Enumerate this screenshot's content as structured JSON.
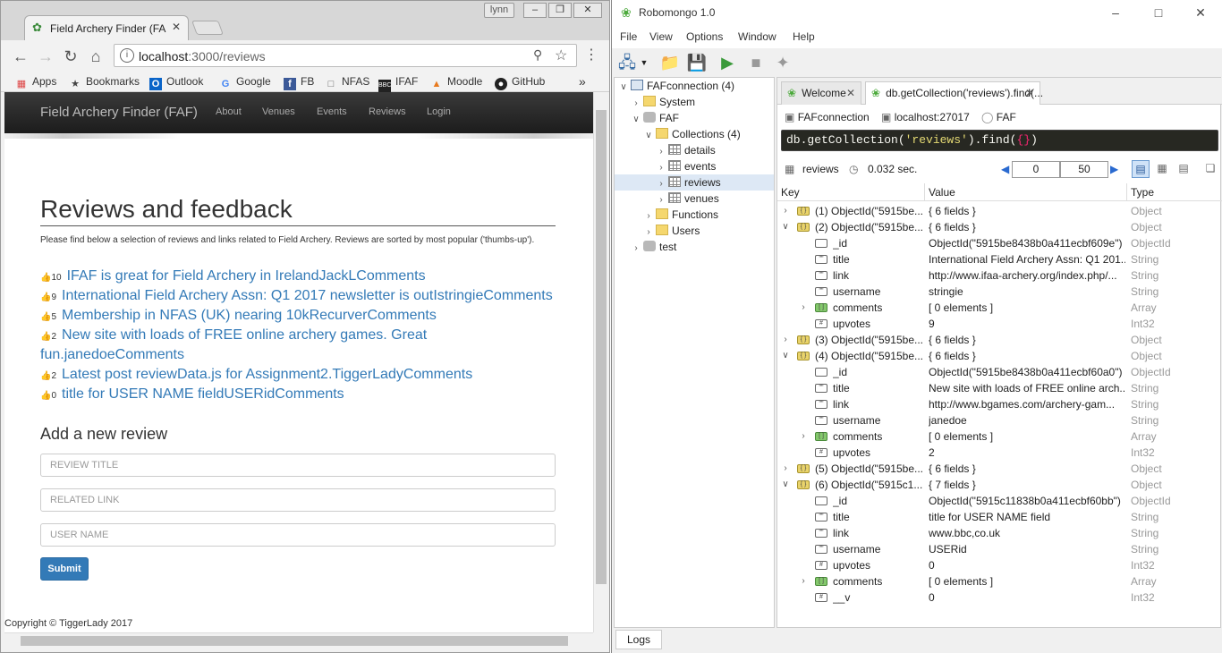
{
  "chrome": {
    "tab_title": "Field Archery Finder (FAF",
    "user": "lynn",
    "url_host": "localhost",
    "url_path": ":3000/reviews",
    "bookmarks": [
      "Apps",
      "Bookmarks",
      "Outlook",
      "Google",
      "FB",
      "NFAS",
      "IFAF",
      "Moodle",
      "GitHub"
    ],
    "bookmark_icons": [
      "apps-icon",
      "star-icon",
      "outlook-icon",
      "google-icon",
      "facebook-icon",
      "document-icon",
      "bbc-icon",
      "moodle-icon",
      "github-icon"
    ]
  },
  "site": {
    "brand": "Field Archery Finder (FAF)",
    "nav": [
      "About",
      "Venues",
      "Events",
      "Reviews",
      "Login"
    ],
    "heading": "Reviews and feedback",
    "intro": "Please find below a selection of reviews and links related to Field Archery. Reviews are sorted by most popular ('thumbs-up').",
    "reviews": [
      {
        "votes": "10",
        "text": "IFAF is great for Field Archery in IrelandJackLComments"
      },
      {
        "votes": "9",
        "text": "International Field Archery Assn: Q1 2017 newsletter is outIstringieComments"
      },
      {
        "votes": "5",
        "text": "Membership in NFAS (UK) nearing 10kRecurverComments"
      },
      {
        "votes": "2",
        "text": "New site with loads of FREE online archery games. Great"
      },
      {
        "votes": "",
        "text": "fun.janedoeComments"
      },
      {
        "votes": "2",
        "text": "Latest post reviewData.js for Assignment2.TiggerLadyComments"
      },
      {
        "votes": "0",
        "text": "title for USER NAME fieldUSERidComments"
      }
    ],
    "add_heading": "Add a new review",
    "fields": {
      "title": "REVIEW TITLE",
      "link": "RELATED LINK",
      "user": "USER NAME"
    },
    "submit": "Submit",
    "copyright": "Copyright © TiggerLady 2017"
  },
  "robo": {
    "title": "Robomongo 1.0",
    "menu": [
      "File",
      "View",
      "Options",
      "Window",
      "Help"
    ],
    "tree": [
      {
        "label": "FAFconnection (4)",
        "icon": "pc",
        "depth": 0,
        "arrow": "v"
      },
      {
        "label": "System",
        "icon": "folder",
        "depth": 1,
        "arrow": ">"
      },
      {
        "label": "FAF",
        "icon": "db",
        "depth": 1,
        "arrow": "v"
      },
      {
        "label": "Collections (4)",
        "icon": "folder",
        "depth": 2,
        "arrow": "v"
      },
      {
        "label": "details",
        "icon": "table",
        "depth": 3,
        "arrow": ">"
      },
      {
        "label": "events",
        "icon": "table",
        "depth": 3,
        "arrow": ">"
      },
      {
        "label": "reviews",
        "icon": "table",
        "depth": 3,
        "arrow": ">",
        "selected": true
      },
      {
        "label": "venues",
        "icon": "table",
        "depth": 3,
        "arrow": ">"
      },
      {
        "label": "Functions",
        "icon": "folder",
        "depth": 2,
        "arrow": ">"
      },
      {
        "label": "Users",
        "icon": "folder",
        "depth": 2,
        "arrow": ">"
      },
      {
        "label": "test",
        "icon": "db",
        "depth": 1,
        "arrow": ">"
      }
    ],
    "tabs": [
      "Welcome",
      "db.getCollection('reviews').find(..."
    ],
    "conn": {
      "name": "FAFconnection",
      "host": "localhost:27017",
      "db": "FAF"
    },
    "query_prefix": "db.getCollection(",
    "query_string": "'reviews'",
    "query_mid": ").find(",
    "query_obj": "{}",
    "query_end": ")",
    "results": {
      "collection": "reviews",
      "time": "0.032 sec.",
      "skip": "0",
      "limit": "50"
    },
    "columns": [
      "Key",
      "Value",
      "Type"
    ],
    "rows": [
      {
        "lvl": 0,
        "arrow": ">",
        "icon": "obj",
        "key": "(1) ObjectId(\"5915be...",
        "value": "{ 6 fields }",
        "type": "Object"
      },
      {
        "lvl": 0,
        "arrow": "v",
        "icon": "obj",
        "key": "(2) ObjectId(\"5915be...",
        "value": "{ 6 fields }",
        "type": "Object"
      },
      {
        "lvl": 1,
        "arrow": "",
        "icon": "oid",
        "key": "_id",
        "value": "ObjectId(\"5915be8438b0a411ecbf609e\")",
        "type": "ObjectId"
      },
      {
        "lvl": 1,
        "arrow": "",
        "icon": "str",
        "key": "title",
        "value": "International Field Archery Assn: Q1 201...",
        "type": "String"
      },
      {
        "lvl": 1,
        "arrow": "",
        "icon": "str",
        "key": "link",
        "value": "http://www.ifaa-archery.org/index.php/...",
        "type": "String"
      },
      {
        "lvl": 1,
        "arrow": "",
        "icon": "str",
        "key": "username",
        "value": "stringie",
        "type": "String"
      },
      {
        "lvl": 1,
        "arrow": ">",
        "icon": "arr",
        "key": "comments",
        "value": "[ 0 elements ]",
        "type": "Array"
      },
      {
        "lvl": 1,
        "arrow": "",
        "icon": "num",
        "key": "upvotes",
        "value": "9",
        "type": "Int32"
      },
      {
        "lvl": 0,
        "arrow": ">",
        "icon": "obj",
        "key": "(3) ObjectId(\"5915be...",
        "value": "{ 6 fields }",
        "type": "Object"
      },
      {
        "lvl": 0,
        "arrow": "v",
        "icon": "obj",
        "key": "(4) ObjectId(\"5915be...",
        "value": "{ 6 fields }",
        "type": "Object"
      },
      {
        "lvl": 1,
        "arrow": "",
        "icon": "oid",
        "key": "_id",
        "value": "ObjectId(\"5915be8438b0a411ecbf60a0\")",
        "type": "ObjectId"
      },
      {
        "lvl": 1,
        "arrow": "",
        "icon": "str",
        "key": "title",
        "value": "New site with loads of FREE online arch...",
        "type": "String"
      },
      {
        "lvl": 1,
        "arrow": "",
        "icon": "str",
        "key": "link",
        "value": "http://www.bgames.com/archery-gam...",
        "type": "String"
      },
      {
        "lvl": 1,
        "arrow": "",
        "icon": "str",
        "key": "username",
        "value": "janedoe",
        "type": "String"
      },
      {
        "lvl": 1,
        "arrow": ">",
        "icon": "arr",
        "key": "comments",
        "value": "[ 0 elements ]",
        "type": "Array"
      },
      {
        "lvl": 1,
        "arrow": "",
        "icon": "num",
        "key": "upvotes",
        "value": "2",
        "type": "Int32"
      },
      {
        "lvl": 0,
        "arrow": ">",
        "icon": "obj",
        "key": "(5) ObjectId(\"5915be...",
        "value": "{ 6 fields }",
        "type": "Object"
      },
      {
        "lvl": 0,
        "arrow": "v",
        "icon": "obj",
        "key": "(6) ObjectId(\"5915c1...",
        "value": "{ 7 fields }",
        "type": "Object"
      },
      {
        "lvl": 1,
        "arrow": "",
        "icon": "oid",
        "key": "_id",
        "value": "ObjectId(\"5915c11838b0a411ecbf60bb\")",
        "type": "ObjectId"
      },
      {
        "lvl": 1,
        "arrow": "",
        "icon": "str",
        "key": "title",
        "value": "title for USER NAME field",
        "type": "String"
      },
      {
        "lvl": 1,
        "arrow": "",
        "icon": "str",
        "key": "link",
        "value": "www.bbc,co.uk",
        "type": "String"
      },
      {
        "lvl": 1,
        "arrow": "",
        "icon": "str",
        "key": "username",
        "value": "USERid",
        "type": "String"
      },
      {
        "lvl": 1,
        "arrow": "",
        "icon": "num",
        "key": "upvotes",
        "value": "0",
        "type": "Int32"
      },
      {
        "lvl": 1,
        "arrow": ">",
        "icon": "arr",
        "key": "comments",
        "value": "[ 0 elements ]",
        "type": "Array"
      },
      {
        "lvl": 1,
        "arrow": "",
        "icon": "num",
        "key": "__v",
        "value": "0",
        "type": "Int32"
      }
    ],
    "logs": "Logs"
  }
}
